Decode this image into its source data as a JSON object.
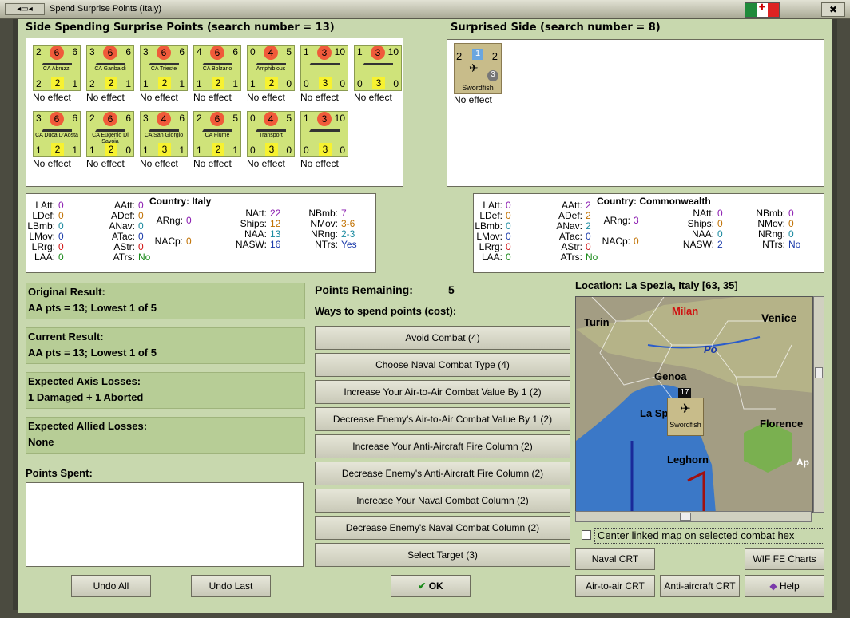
{
  "window": {
    "title": "Spend Surprise Points (Italy)",
    "close": "✖"
  },
  "left_panel": {
    "heading": "Side Spending Surprise Points (search number = 13)",
    "units": [
      {
        "n": "CA Abruzzi",
        "tl": "2",
        "tc": "6",
        "tr": "6",
        "bl": "2",
        "bc": "2",
        "br": "1",
        "effect": "No effect"
      },
      {
        "n": "CA Garibaldi",
        "tl": "3",
        "tc": "6",
        "tr": "6",
        "bl": "2",
        "bc": "2",
        "br": "1",
        "effect": "No effect"
      },
      {
        "n": "CA Trieste",
        "tl": "3",
        "tc": "6",
        "tr": "6",
        "bl": "1",
        "bc": "2",
        "br": "1",
        "effect": "No effect"
      },
      {
        "n": "CA Bolzano",
        "tl": "4",
        "tc": "6",
        "tr": "6",
        "bl": "1",
        "bc": "2",
        "br": "1",
        "effect": "No effect"
      },
      {
        "n": "Amphibious",
        "tl": "0",
        "tc": "4",
        "tr": "5",
        "bl": "1",
        "bc": "2",
        "br": "0",
        "effect": "No effect"
      },
      {
        "n": "",
        "tl": "1",
        "tc": "3",
        "tr": "10",
        "bl": "0",
        "bc": "3",
        "br": "0",
        "effect": "No effect"
      },
      {
        "n": "",
        "tl": "1",
        "tc": "3",
        "tr": "10",
        "bl": "0",
        "bc": "3",
        "br": "0",
        "effect": "No effect"
      },
      {
        "n": "CA Duca D'Aosta",
        "tl": "3",
        "tc": "6",
        "tr": "6",
        "bl": "1",
        "bc": "2",
        "br": "1",
        "effect": "No effect"
      },
      {
        "n": "CA Eugenio Di Savoia",
        "tl": "2",
        "tc": "6",
        "tr": "6",
        "bl": "1",
        "bc": "2",
        "br": "0",
        "effect": "No effect"
      },
      {
        "n": "CA San Giorgio",
        "tl": "3",
        "tc": "4",
        "tr": "6",
        "bl": "1",
        "bc": "3",
        "br": "1",
        "effect": "No effect"
      },
      {
        "n": "CA Fiume",
        "tl": "2",
        "tc": "6",
        "tr": "5",
        "bl": "1",
        "bc": "2",
        "br": "1",
        "effect": "No effect"
      },
      {
        "n": "Transport",
        "tl": "0",
        "tc": "4",
        "tr": "5",
        "bl": "0",
        "bc": "3",
        "br": "0",
        "effect": "No effect"
      },
      {
        "n": "",
        "tl": "1",
        "tc": "3",
        "tr": "10",
        "bl": "0",
        "bc": "3",
        "br": "0",
        "effect": "No effect"
      }
    ]
  },
  "right_panel": {
    "heading": "Surprised Side (search number = 8)",
    "unit": {
      "n": "Swordfish",
      "tl": "2",
      "tc": "1",
      "tr": "2",
      "b": "3",
      "effect": "No effect"
    }
  },
  "stats_left": {
    "country_label": "Country: Italy",
    "c1": [
      [
        "LAtt:",
        "0"
      ],
      [
        "LDef:",
        "0"
      ],
      [
        "LBmb:",
        "0"
      ],
      [
        "LMov:",
        "0"
      ],
      [
        "LRrg:",
        "0"
      ],
      [
        "LAA:",
        "0"
      ]
    ],
    "c2": [
      [
        "AAtt:",
        "0"
      ],
      [
        "ADef:",
        "0"
      ],
      [
        "ANav:",
        "0"
      ],
      [
        "ATac:",
        "0"
      ],
      [
        "AStr:",
        "0"
      ],
      [
        "ATrs:",
        "No"
      ]
    ],
    "c3": [
      [
        "ARng:",
        "0"
      ],
      [
        "NACp:",
        "0"
      ]
    ],
    "c4": [
      [
        "NAtt:",
        "22"
      ],
      [
        "Ships:",
        "12"
      ],
      [
        "NAA:",
        "13"
      ],
      [
        "NASW:",
        "16"
      ]
    ],
    "c5": [
      [
        "NBmb:",
        "7"
      ],
      [
        "NMov:",
        "3-6"
      ],
      [
        "NRng:",
        "2-3"
      ],
      [
        "NTrs:",
        "Yes"
      ]
    ]
  },
  "stats_right": {
    "country_label": "Country: Commonwealth",
    "c1": [
      [
        "LAtt:",
        "0"
      ],
      [
        "LDef:",
        "0"
      ],
      [
        "LBmb:",
        "0"
      ],
      [
        "LMov:",
        "0"
      ],
      [
        "LRrg:",
        "0"
      ],
      [
        "LAA:",
        "0"
      ]
    ],
    "c2": [
      [
        "AAtt:",
        "2"
      ],
      [
        "ADef:",
        "2"
      ],
      [
        "ANav:",
        "2"
      ],
      [
        "ATac:",
        "0"
      ],
      [
        "AStr:",
        "0"
      ],
      [
        "ATrs:",
        "No"
      ]
    ],
    "c3": [
      [
        "ARng:",
        "3"
      ],
      [
        "NACp:",
        "0"
      ]
    ],
    "c4": [
      [
        "NAtt:",
        "0"
      ],
      [
        "Ships:",
        "0"
      ],
      [
        "NAA:",
        "0"
      ],
      [
        "NASW:",
        "2"
      ]
    ],
    "c5": [
      [
        "NBmb:",
        "0"
      ],
      [
        "NMov:",
        "0"
      ],
      [
        "NRng:",
        "0"
      ],
      [
        "NTrs:",
        "No"
      ]
    ]
  },
  "results": {
    "original_h": "Original Result:",
    "original_v": "AA pts = 13; Lowest 1 of 5",
    "current_h": "Current Result:",
    "current_v": "AA pts = 13; Lowest 1 of 5",
    "axis_h": "Expected Axis Losses:",
    "axis_v": "1 Damaged + 1 Aborted",
    "allied_h": "Expected Allied Losses:",
    "allied_v": "None",
    "spent_h": "Points Spent:"
  },
  "points": {
    "label": "Points Remaining:",
    "value": "5",
    "ways": "Ways to spend points (cost):"
  },
  "options": [
    "Avoid Combat (4)",
    "Choose Naval Combat Type (4)",
    "Increase Your Air-to-Air Combat Value By 1 (2)",
    "Decrease Enemy's Air-to-Air Combat Value By 1 (2)",
    "Increase Your Anti-Aircraft Fire Column (2)",
    "Decrease Enemy's Anti-Aircraft Fire Column (2)",
    "Increase Your Naval Combat Column (2)",
    "Decrease Enemy's Naval Combat Column (2)",
    "Select Target (3)"
  ],
  "buttons": {
    "undo_all": "Undo All",
    "undo_last": "Undo Last",
    "ok": "OK",
    "naval_crt": "Naval CRT",
    "wif_charts": "WIF FE Charts",
    "air_crt": "Air-to-air CRT",
    "aa_crt": "Anti-aircraft CRT",
    "help": "Help"
  },
  "location": "Location: La Spezia, Italy [63, 35]",
  "map": {
    "cities": [
      "Turin",
      "Milan",
      "Venice",
      "Genoa",
      "La Sp",
      "Florence",
      "Leghorn",
      "Ap"
    ],
    "river": "Po",
    "counter_stack": "17",
    "unit": "Swordfish"
  },
  "center_check": "Center linked map on selected combat hex",
  "colors": {
    "counter": "#cfe37a",
    "panel": "#c8d8ae",
    "field": "#b7cd96"
  }
}
